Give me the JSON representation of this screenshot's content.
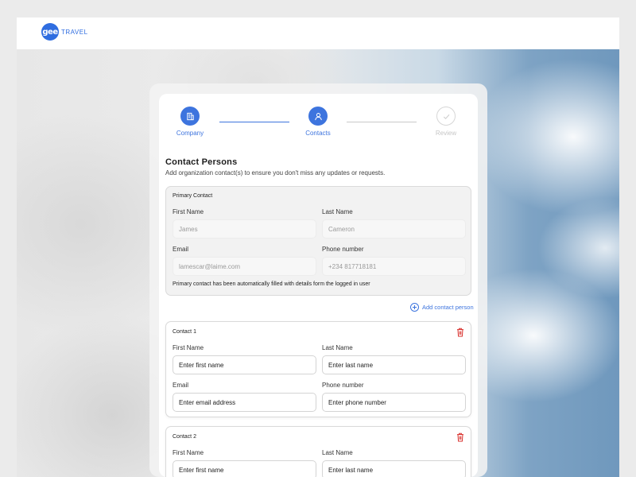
{
  "brand": {
    "mark": "gee",
    "name": "TRAVEL"
  },
  "stepper": [
    {
      "label": "Company",
      "icon": "building-icon",
      "state": "active"
    },
    {
      "label": "Contacts",
      "icon": "user-icon",
      "state": "active"
    },
    {
      "label": "Review",
      "icon": "check-icon",
      "state": "inactive"
    }
  ],
  "section": {
    "title": "Contact Persons",
    "subtitle": "Add organization contact(s) to ensure you don't miss any updates or requests."
  },
  "primary_contact": {
    "title": "Primary Contact",
    "first_name_label": "First Name",
    "first_name_value": "James",
    "last_name_label": "Last Name",
    "last_name_value": "Cameron",
    "email_label": "Email",
    "email_value": "lamescar@laime.com",
    "phone_label": "Phone number",
    "phone_value": "+234 817718181",
    "note": "Primary contact has been  automatically filled with details form the logged in user"
  },
  "add_contact_label": "Add contact person",
  "contacts": [
    {
      "title": "Contact 1",
      "first_name_label": "First Name",
      "first_name_placeholder": "Enter first name",
      "last_name_label": "Last Name",
      "last_name_placeholder": "Enter last name",
      "email_label": "Email",
      "email_placeholder": "Enter email address",
      "phone_label": "Phone number",
      "phone_placeholder": "Enter phone number"
    },
    {
      "title": "Contact 2",
      "first_name_label": "First Name",
      "first_name_placeholder": "Enter first name",
      "last_name_label": "Last Name",
      "last_name_placeholder": "Enter last name"
    }
  ],
  "colors": {
    "accent": "#3d74de",
    "danger": "#d9302c",
    "inactive": "#c6c6c6"
  }
}
